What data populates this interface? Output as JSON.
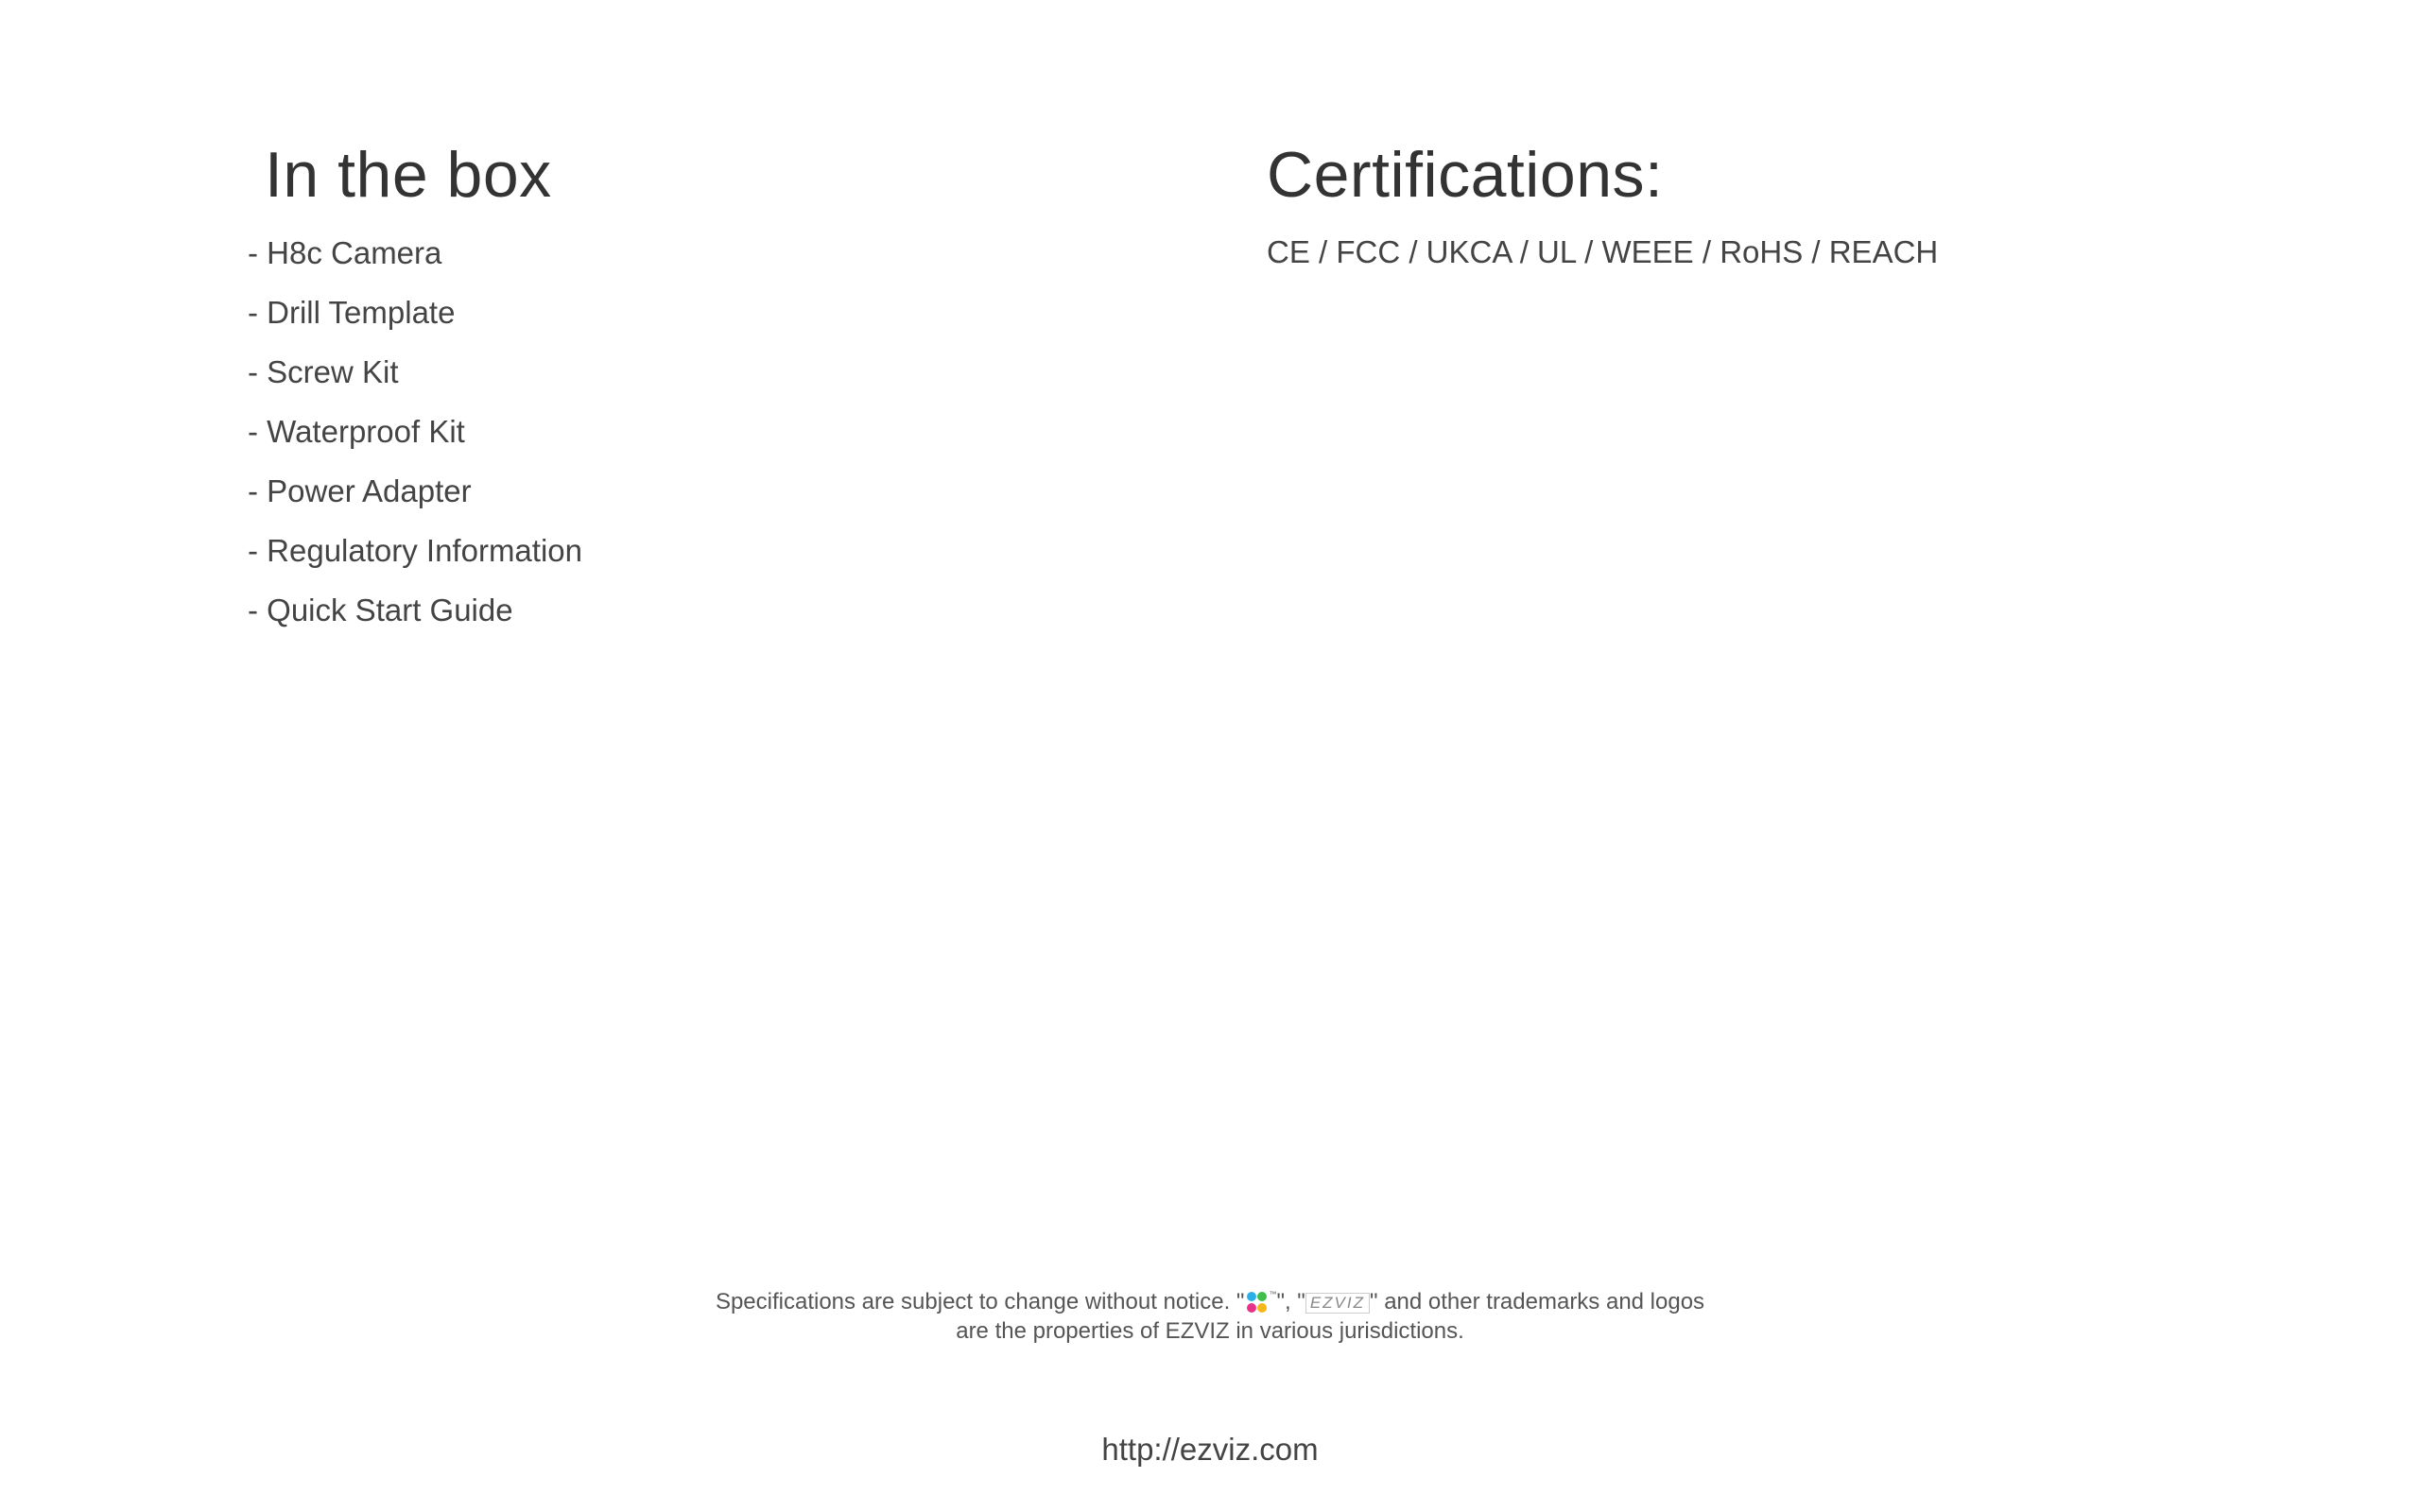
{
  "in_the_box": {
    "heading": "In the box",
    "items": [
      "- H8c Camera",
      "- Drill Template",
      "- Screw Kit",
      "- Waterproof Kit",
      "- Power Adapter",
      "- Regulatory Information",
      "- Quick Start Guide"
    ]
  },
  "certifications": {
    "heading": "Certifications:",
    "text": "CE / FCC / UKCA / UL / WEEE / RoHS / REACH"
  },
  "footer": {
    "note_prefix": "Specifications are subject to change without notice.  \"",
    "note_sep": "\", \"",
    "wordmark_text": "EZVIZ",
    "note_suffix": "\" and other trademarks and logos",
    "note_line2": "are the properties of EZVIZ in various jurisdictions.",
    "url": "http://ezviz.com",
    "logo_colors": [
      "#2ab0e8",
      "#3dbf4a",
      "#e8328a",
      "#f3b71c"
    ]
  }
}
